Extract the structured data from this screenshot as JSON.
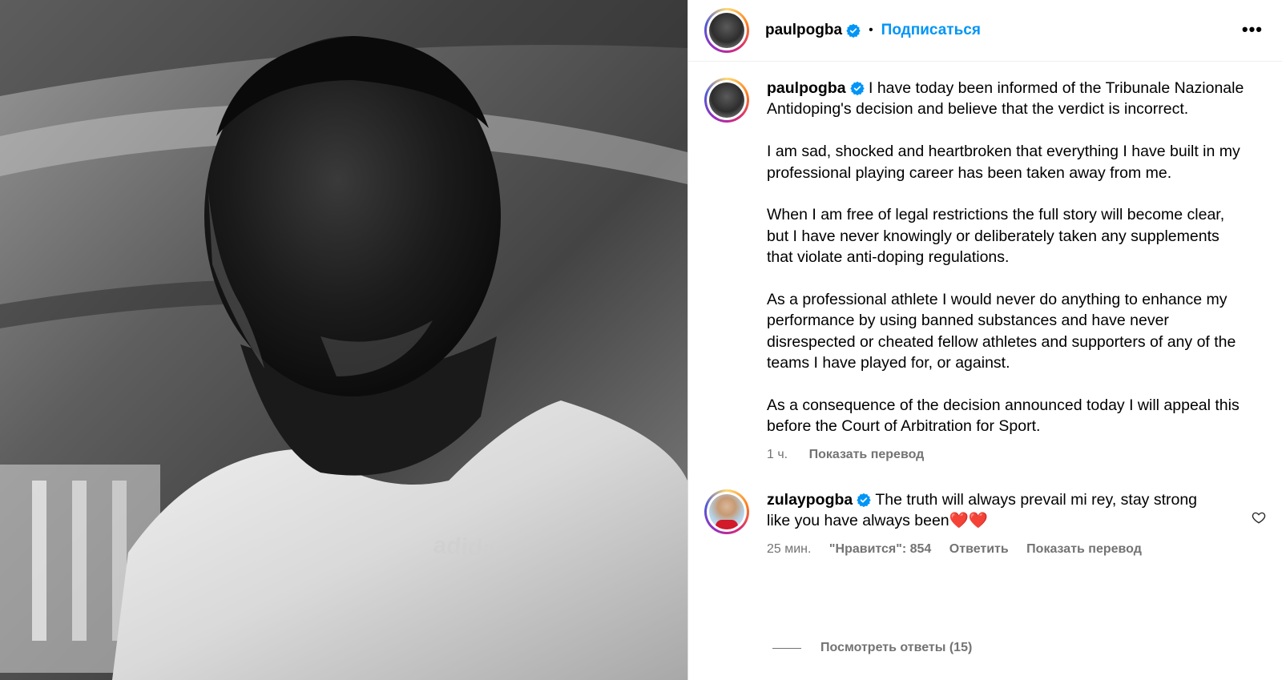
{
  "header": {
    "username": "paulpogba",
    "separator": "•",
    "follow_label": "Подписаться",
    "more_label": "•••"
  },
  "caption": {
    "username": "paulpogba",
    "paragraphs": [
      "I have today been informed of the Tribunale Nazionale Antidoping's decision and believe that the verdict is incorrect.",
      "I am sad, shocked and heartbroken that everything I have built in my professional playing career has been taken away from me.",
      "When I am free of legal restrictions the full story will become clear, but I have never knowingly or deliberately taken any supplements that violate anti-doping regulations.",
      "As a professional athlete I would never do anything to enhance my performance by using banned substances and have never disrespected or cheated fellow athletes and supporters of any of the teams I have played for, or against.",
      "As a consequence of the decision announced today I will appeal this before the Court of Arbitration for Sport."
    ],
    "time": "1 ч.",
    "translate_label": "Показать перевод"
  },
  "comment": {
    "username": "zulaypogba",
    "text": "The truth will always prevail mi rey, stay strong like you have always been",
    "emoji": "❤️❤️",
    "time": "25 мин.",
    "likes": "\"Нравится\": 854",
    "reply_label": "Ответить",
    "translate_label": "Показать перевод",
    "view_replies_label": "Посмотреть ответы (15)"
  },
  "photo": {
    "shirt_logo_text": "adidas"
  },
  "colors": {
    "accent": "#0095f6",
    "verified": "#0095f6",
    "muted": "#737373"
  }
}
